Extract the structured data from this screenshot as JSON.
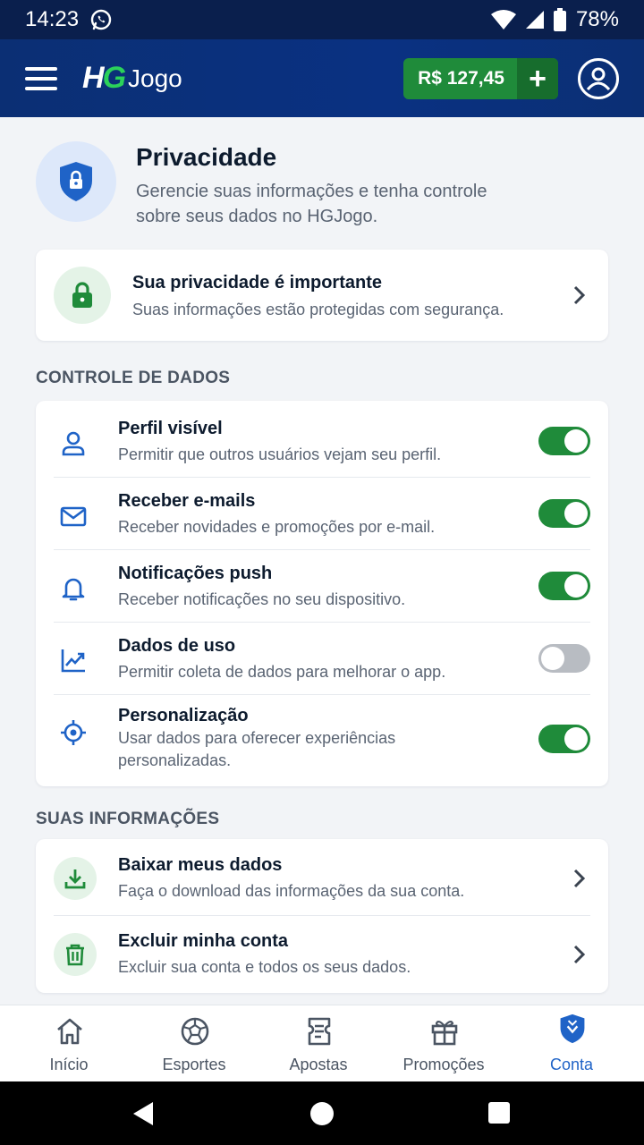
{
  "status_bar": {
    "time": "14:23",
    "battery": "78%"
  },
  "header": {
    "logo_mark": "HG",
    "logo_text": "Jogo",
    "balance": "R$ 127,45",
    "add_label": "+"
  },
  "page": {
    "title": "Privacidade",
    "subtitle": "Gerencie suas informações e tenha controle sobre seus dados no HGJogo."
  },
  "privacy_banner": {
    "title": "Sua privacidade é importante",
    "description": "Suas informações estão protegidas com segurança."
  },
  "data_control": {
    "section_label": "CONTROLE DE DADOS",
    "items": [
      {
        "title": "Perfil visível",
        "description": "Permitir que outros usuários vejam seu perfil.",
        "enabled": true,
        "icon": "user-icon"
      },
      {
        "title": "Receber e-mails",
        "description": "Receber novidades e promoções por e-mail.",
        "enabled": true,
        "icon": "mail-icon"
      },
      {
        "title": "Notificações push",
        "description": "Receber notificações no seu dispositivo.",
        "enabled": true,
        "icon": "bell-icon"
      },
      {
        "title": "Dados de uso",
        "description": "Permitir coleta de dados para melhorar o app.",
        "enabled": false,
        "icon": "chart-icon"
      },
      {
        "title": "Personalização",
        "description": "Usar dados para oferecer experiências personalizadas.",
        "enabled": true,
        "icon": "target-icon"
      }
    ]
  },
  "your_info": {
    "section_label": "SUAS INFORMAÇÕES",
    "items": [
      {
        "title": "Baixar meus dados",
        "description": "Faça o download das informações da sua conta.",
        "icon": "download-icon"
      },
      {
        "title": "Excluir minha conta",
        "description": "Excluir sua conta e todos os seus dados.",
        "icon": "trash-icon"
      }
    ]
  },
  "bottom_nav": {
    "active": "Conta",
    "items": [
      {
        "label": "Início",
        "icon": "home-icon"
      },
      {
        "label": "Esportes",
        "icon": "ball-icon"
      },
      {
        "label": "Apostas",
        "icon": "ticket-icon"
      },
      {
        "label": "Promoções",
        "icon": "gift-icon"
      },
      {
        "label": "Conta",
        "icon": "shield-icon"
      }
    ]
  },
  "colors": {
    "header_bg": "#0b2f74",
    "accent_green": "#1f8b3a",
    "active_blue": "#1f63c7",
    "page_bg": "#f2f4f7"
  }
}
